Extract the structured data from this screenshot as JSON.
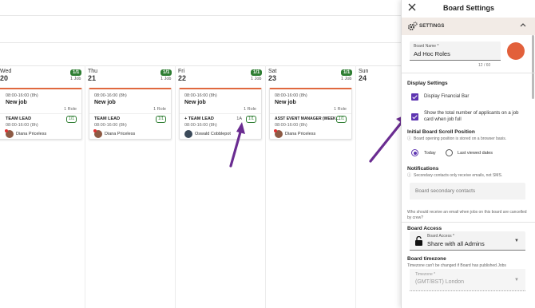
{
  "days": [
    {
      "name": "Wed",
      "date": "20",
      "badge": "1/1",
      "jobs": "1 Job"
    },
    {
      "name": "Thu",
      "date": "21",
      "badge": "1/1",
      "jobs": "1 Job"
    },
    {
      "name": "Fri",
      "date": "22",
      "badge": "1/1",
      "jobs": "1 Job"
    },
    {
      "name": "Sat",
      "date": "23",
      "badge": "1/1",
      "jobs": "1 Job"
    },
    {
      "name": "Sun",
      "date": "24"
    }
  ],
  "cards": [
    {
      "time": "08:00-16:00 (8h)",
      "title": "New job",
      "roles": "1 Role",
      "role_title": "TEAM LEAD",
      "role_time": "08:00-16:00 (8h)",
      "role_badge": "1/1",
      "person": "Diana Priceless"
    },
    {
      "time": "08:00-16:00 (8h)",
      "title": "New job",
      "roles": "1 Role",
      "role_title": "TEAM LEAD",
      "role_time": "08:00-16:00 (8h)",
      "role_badge": "1/1",
      "person": "Diana Priceless"
    },
    {
      "time": "08:00-16:00 (8h)",
      "title": "New job",
      "roles": "1 Role",
      "role_title": "+ TEAM LEAD",
      "role_time": "08:00-16:00 (8h)",
      "role_badge": "1/1",
      "role_extra": "1A",
      "person": "Oswald Cobblepot"
    },
    {
      "time": "08:00-16:00 (8h)",
      "title": "New job",
      "roles": "1 Role",
      "role_title": "ASST EVENT MANAGER (WEEK...",
      "role_time": "08:00-16:00 (8h)",
      "role_badge": "1/1",
      "person": "Diana Priceless"
    }
  ],
  "panel": {
    "title": "Board Settings",
    "section": "SETTINGS",
    "board_name_label": "Board Name *",
    "board_name_value": "Ad Hoc Roles",
    "board_name_counter": "12 / 60",
    "board_color": "#e2603b",
    "display_settings_heading": "Display Settings",
    "display_financial_bar": "Display Financial Bar",
    "show_applicants": "Show the total number of applicants on a job card when job full",
    "scroll_heading": "Initial Board Scroll Position",
    "scroll_note": "Board opening position is stored on a browser basis.",
    "scroll_today": "Today",
    "scroll_last": "Last viewed dates",
    "notifications_heading": "Notifications",
    "notifications_note": "Secondary contacts only receive emails, not SMS.",
    "secondary_contacts_placeholder": "Board secondary contacts",
    "cancel_email_note": "Who should receive an email when jobs on this board are cancelled by crew?",
    "access_heading": "Board Access",
    "access_label": "Board Access *",
    "access_value": "Share with all Admins",
    "timezone_heading": "Board timezone",
    "timezone_note": "Timezone can't be changed if Board has published Jobs",
    "timezone_label": "Timezone *",
    "timezone_value": "(GMT/BST) London"
  },
  "accent": "#5e35b1",
  "badge_color": "#2e7d32"
}
